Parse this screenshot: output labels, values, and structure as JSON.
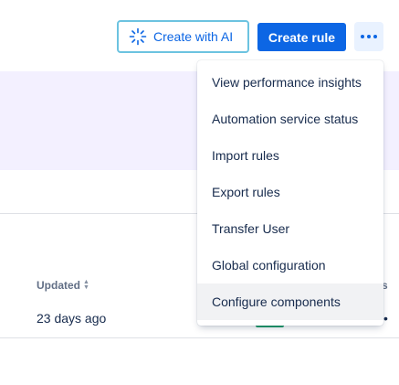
{
  "toolbar": {
    "create_with_ai_label": "Create with AI",
    "create_rule_label": "Create rule",
    "more_icon": "more-horizontal-icon",
    "ai_icon": "sparkle-icon"
  },
  "menu": {
    "items": [
      {
        "label": "View performance insights"
      },
      {
        "label": "Automation service status"
      },
      {
        "label": "Import rules"
      },
      {
        "label": "Export rules"
      },
      {
        "label": "Transfer User"
      },
      {
        "label": "Global configuration"
      },
      {
        "label": "Configure components"
      }
    ]
  },
  "table": {
    "columns": [
      "Updated"
    ],
    "column_fragment_right": "s",
    "rows": [
      {
        "updated": "23 days ago",
        "fragment_right": "•"
      }
    ]
  },
  "colors": {
    "primary": "#0c66e4",
    "banner": "#f3f0ff",
    "ai_border": "#6cc3e0",
    "status_green": "#22a06b"
  }
}
